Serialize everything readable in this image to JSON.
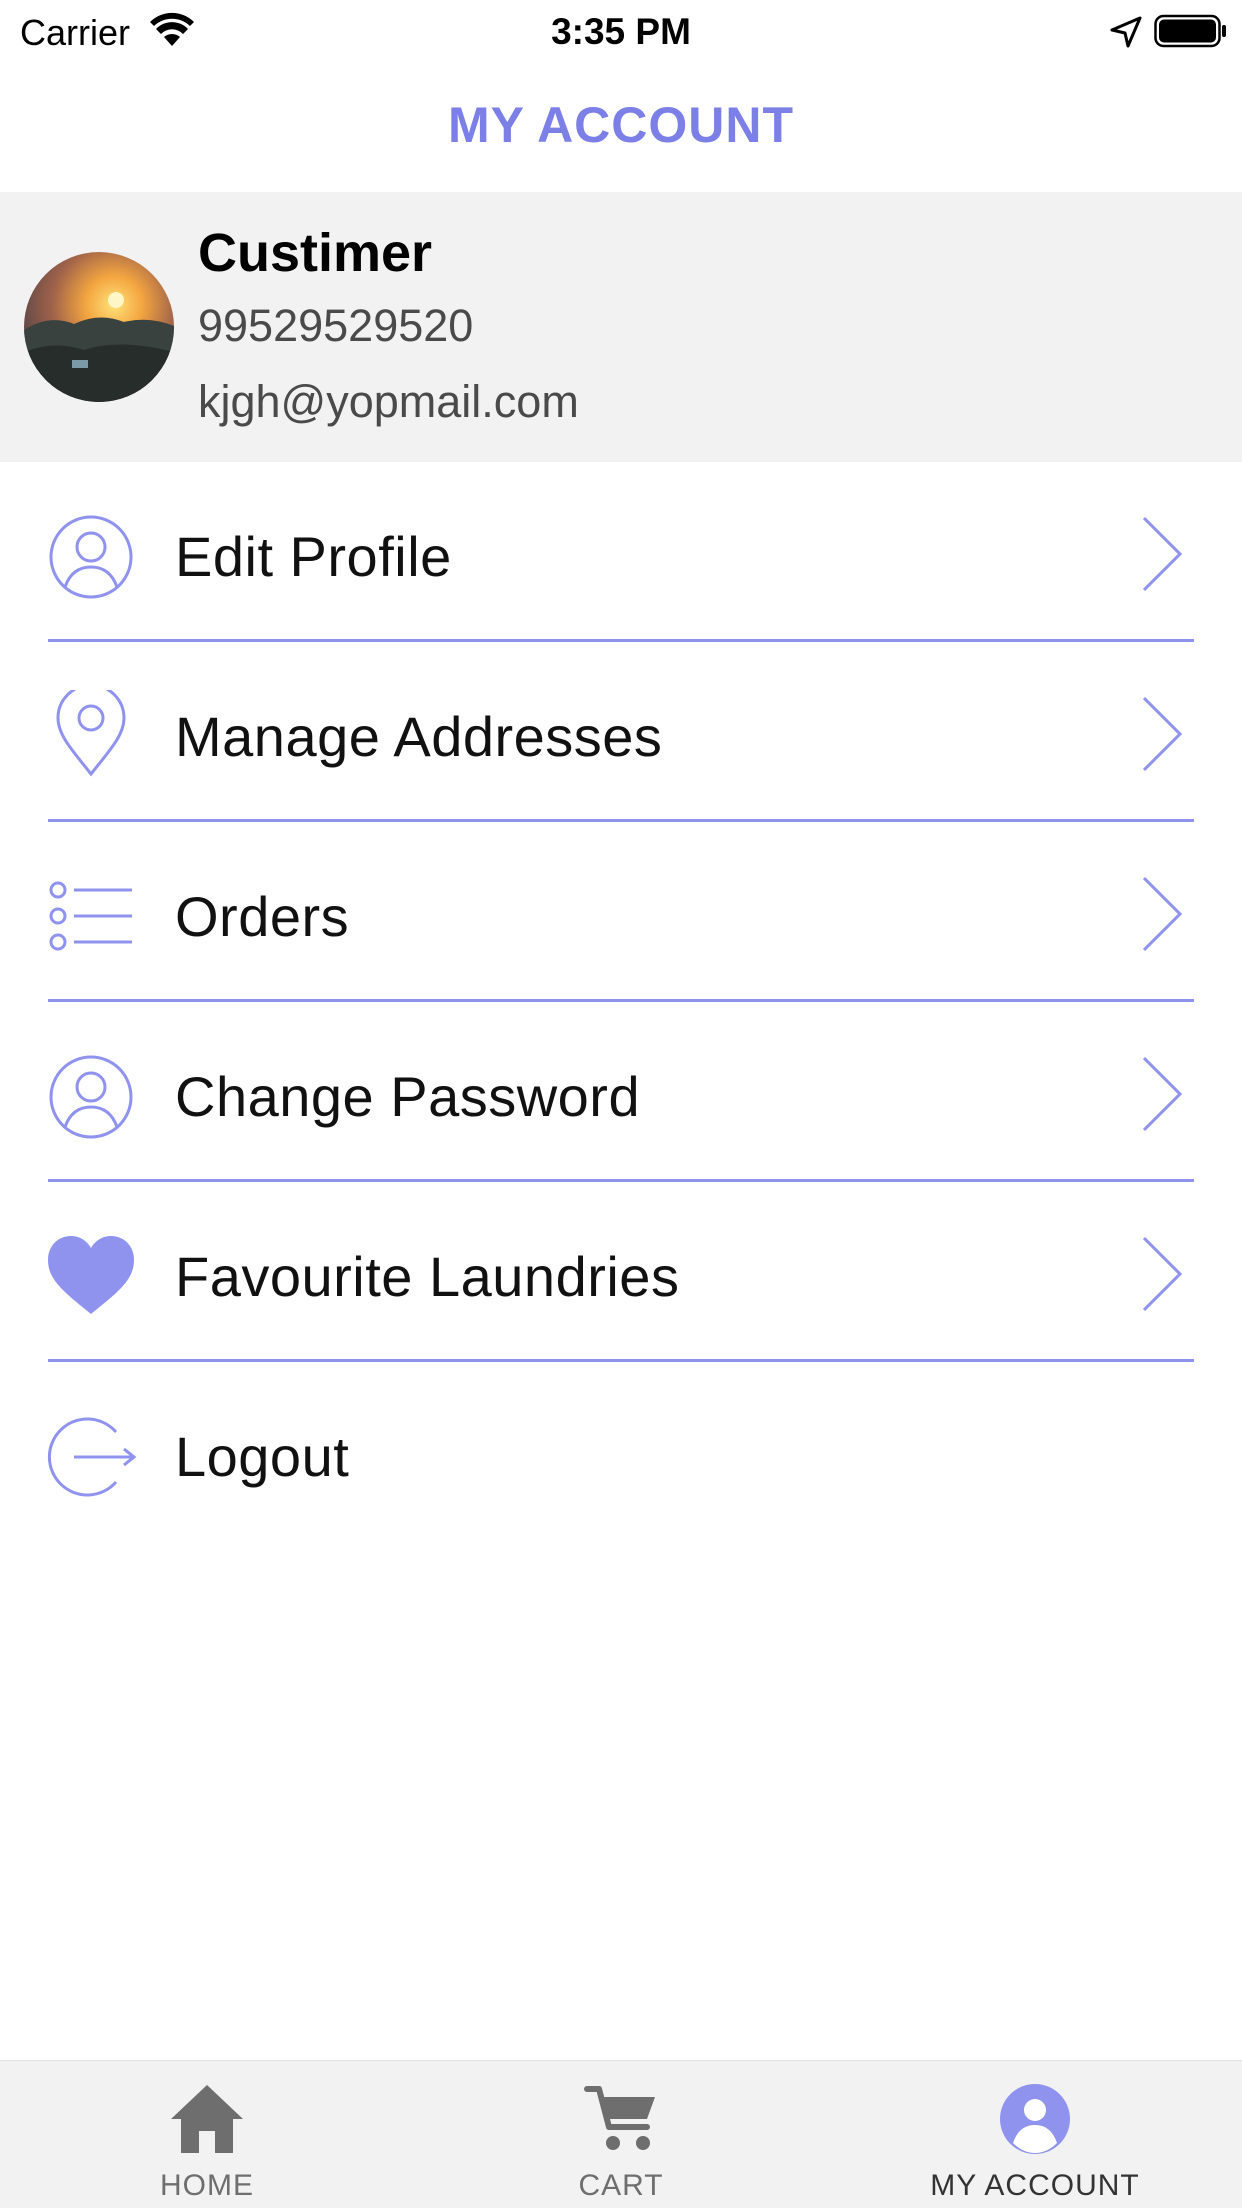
{
  "status_bar": {
    "carrier": "Carrier",
    "time": "3:35 PM"
  },
  "header": {
    "title": "MY ACCOUNT"
  },
  "profile": {
    "name": "Custimer",
    "phone": "99529529520",
    "email": "kjgh@yopmail.com"
  },
  "menu": {
    "items": [
      {
        "label": "Edit Profile",
        "icon": "user-circle-icon"
      },
      {
        "label": "Manage Addresses",
        "icon": "location-pin-icon"
      },
      {
        "label": "Orders",
        "icon": "list-icon"
      },
      {
        "label": "Change Password",
        "icon": "user-circle-icon"
      },
      {
        "label": "Favourite Laundries",
        "icon": "heart-icon"
      },
      {
        "label": "Logout",
        "icon": "logout-icon"
      }
    ]
  },
  "tab_bar": {
    "tabs": [
      {
        "label": "HOME",
        "icon": "home-icon"
      },
      {
        "label": "CART",
        "icon": "cart-icon"
      },
      {
        "label": "MY ACCOUNT",
        "icon": "account-icon",
        "active": true
      }
    ]
  },
  "colors": {
    "accent": "#7b7fe6",
    "icon": "#8f93ee",
    "active_tab_icon": "#8f93ee",
    "inactive_tab_icon": "#6e6e6e",
    "card_background": "#f2f2f2"
  }
}
